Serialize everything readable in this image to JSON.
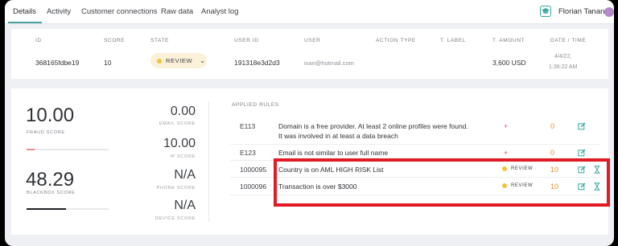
{
  "nav": {
    "tabs": [
      {
        "label": "Details"
      },
      {
        "label": "Activity"
      },
      {
        "label": "Customer connections"
      },
      {
        "label": "Raw data"
      },
      {
        "label": "Analyst log"
      }
    ],
    "user_name": "Florian Tanant"
  },
  "header_table": {
    "columns": [
      "ID",
      "SCORE",
      "STATE",
      "USER ID",
      "USER",
      "ACTION TYPE",
      "T. LABEL",
      "T. AMOUNT",
      "DATE / TIME"
    ],
    "row": {
      "id": "368165fdbe19",
      "score": "10",
      "state": "REVIEW",
      "user_id": "191318e3d2d3",
      "user": "ivan@hotmail.com",
      "action_type": "",
      "t_label": "",
      "t_amount": "3,600 USD",
      "date": "4/4/22,",
      "time": "1:36:22 AM"
    }
  },
  "scores": {
    "fraud": {
      "value": "10.00",
      "label": "FRAUD SCORE",
      "bar_fraction": 0.1,
      "bar_color": "#f28b8b"
    },
    "blackbox": {
      "value": "48.29",
      "label": "BLACKBOX SCORE",
      "bar_fraction": 0.48,
      "bar_color": "#1f2226"
    },
    "email": {
      "value": "0.00",
      "label": "EMAIL SCORE"
    },
    "ip": {
      "value": "10.00",
      "label": "IP SCORE"
    },
    "phone": {
      "value": "N/A",
      "label": "PHONE SCORE"
    },
    "device": {
      "value": "N/A",
      "label": "DEVICE SCORE"
    }
  },
  "rules": {
    "title": "APPLIED RULES",
    "items": [
      {
        "id": "E113",
        "description": "Domain is a free provider. At least 2 online profiles were found. It was involved in at least a data breach",
        "state": "+",
        "score": "0"
      },
      {
        "id": "E123",
        "description": "Email is not similar to user full name",
        "state": "+",
        "score": "0"
      },
      {
        "id": "1000095",
        "description": "Country is on AML HIGH RISK List",
        "state": "REVIEW",
        "score": "10"
      },
      {
        "id": "1000096",
        "description": "Transaction is over $3000",
        "state": "REVIEW",
        "score": "10"
      }
    ]
  },
  "colors": {
    "accent": "#4aa3a1",
    "review_dot": "#f0c53a",
    "score_orange": "#f08a2b",
    "plus_red": "#e8534f",
    "highlight_red": "#e01b24"
  }
}
